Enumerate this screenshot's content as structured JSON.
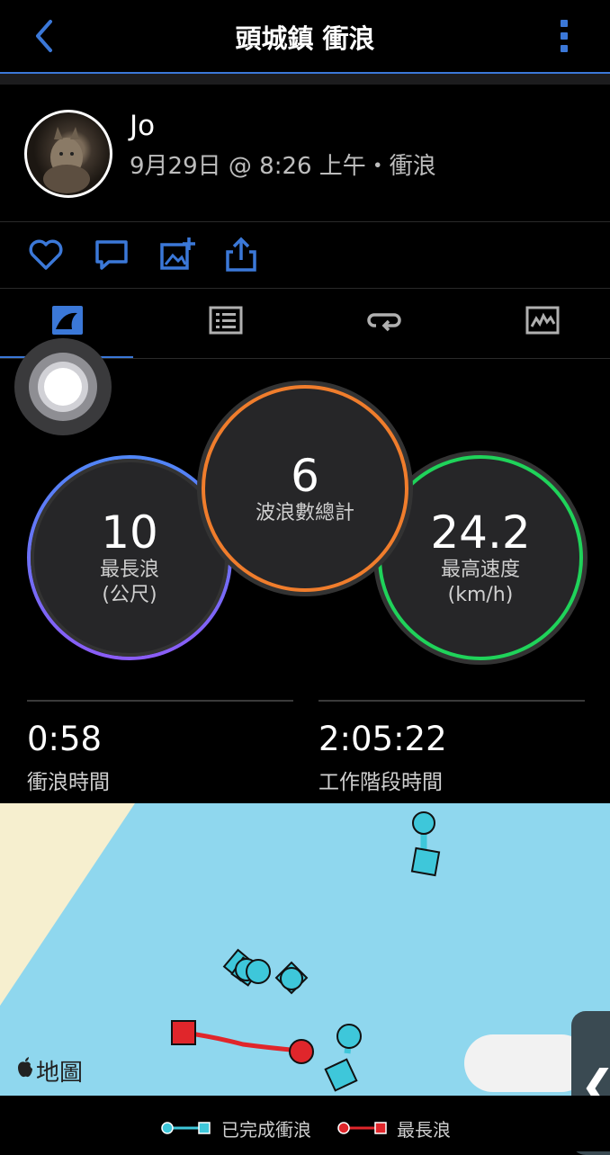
{
  "header": {
    "title": "頭城鎮 衝浪",
    "back_icon": "chevron-left-icon",
    "more_icon": "vertical-dots-icon"
  },
  "user": {
    "name": "Jo",
    "meta": "9月29日 @ 8:26 上午・衝浪"
  },
  "actions": [
    "heart-icon",
    "comment-icon",
    "add-photo-icon",
    "share-icon"
  ],
  "tabs": [
    "stats-tab-icon",
    "list-tab-icon",
    "loop-tab-icon",
    "chart-tab-icon"
  ],
  "stats": {
    "longest_wave": {
      "value": "10",
      "label1": "最長浪",
      "label2": "(公尺)"
    },
    "total_waves": {
      "value": "6",
      "label": "波浪數總計"
    },
    "max_speed": {
      "value": "24.2",
      "label1": "最高速度",
      "label2": "(km/h)"
    }
  },
  "times": {
    "surf_time": {
      "value": "0:58",
      "label": "衝浪時間"
    },
    "session_time": {
      "value": "2:05:22",
      "label": "工作階段時間"
    }
  },
  "map": {
    "logo_text": "地圖"
  },
  "legend": {
    "completed": "已完成衝浪",
    "longest": "最長浪"
  },
  "colors": {
    "accent": "#3b78d8",
    "orange": "#f07d2c",
    "green": "#1fd35a",
    "purple": "#8b5cf6",
    "wave": "#3ec7da",
    "longest": "#e0262b"
  }
}
